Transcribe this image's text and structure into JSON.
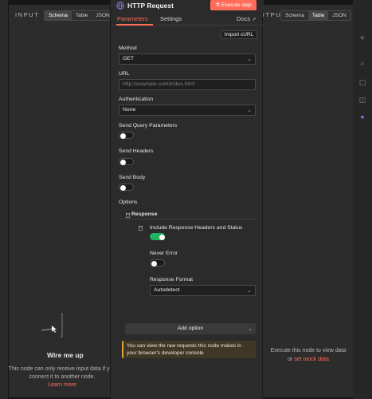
{
  "input_panel": {
    "label": "INPUT",
    "tabs": [
      "Schema",
      "Table",
      "JSON"
    ],
    "active_tab": "Schema",
    "empty_title": "Wire me up",
    "empty_text": "This node can only receive input data if you connect it to another node.",
    "learn_more": "Learn more"
  },
  "output_panel": {
    "label": "OUTPUT",
    "tabs": [
      "Schema",
      "Table",
      "JSON"
    ],
    "active_tab": "Table",
    "text_prefix": "Execute this node to view data",
    "text_or": "or",
    "mock_link": "set mock data"
  },
  "node": {
    "title": "HTTP Request",
    "execute_label": "Execute step",
    "tabs": [
      "Parameters",
      "Settings"
    ],
    "active_tab": "Parameters",
    "docs_label": "Docs",
    "import_curl_label": "Import cURL",
    "method_label": "Method",
    "method_value": "GET",
    "url_label": "URL",
    "url_placeholder": "http://example.com/index.html",
    "auth_label": "Authentication",
    "auth_value": "None",
    "send_query_label": "Send Query Parameters",
    "send_headers_label": "Send Headers",
    "send_body_label": "Send Body",
    "options_label": "Options",
    "response_label": "Response",
    "include_headers_label": "Include Response Headers and Status",
    "never_error_label": "Never Error",
    "response_format_label": "Response Format",
    "response_format_value": "Autodetect",
    "add_option_label": "Add option",
    "notice_text": "You can view the raw requests this node makes in your browser's developer console"
  },
  "toggles": {
    "send_query": false,
    "send_headers": false,
    "send_body": false,
    "include_headers": true,
    "never_error": false
  },
  "colors": {
    "accent": "#ff6d5a",
    "toggle_on": "#22b35e",
    "notice_border": "#e6a23c"
  }
}
